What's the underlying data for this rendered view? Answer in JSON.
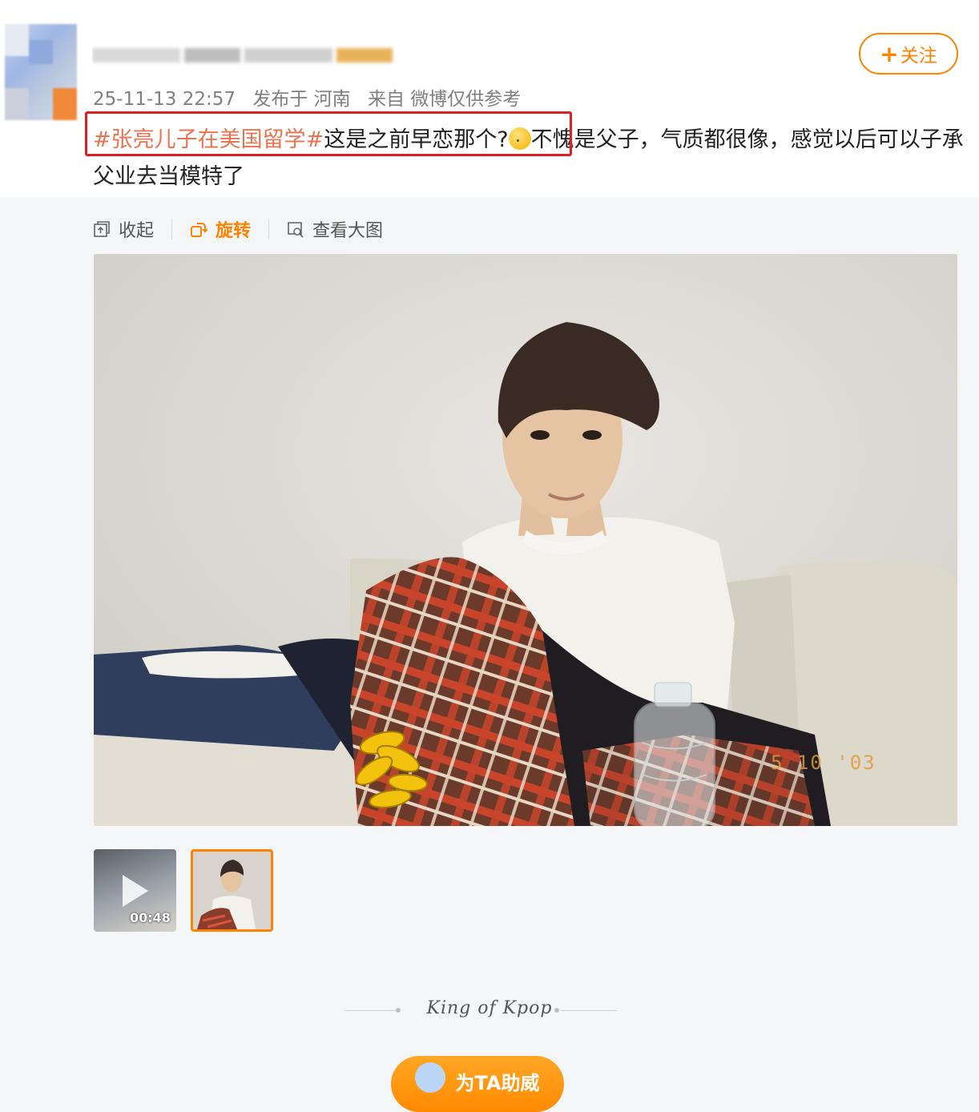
{
  "post": {
    "meta_time": "25-11-13 22:57",
    "meta_location": "发布于 河南",
    "meta_source": "来自 微博仅供参考",
    "follow_label": "关注",
    "follow_plus": "+",
    "hashtag": "#张亮儿子在美国留学#",
    "text_part1": "这是之前早恋那个?",
    "text_part2": "不愧是父子，气质都很像，感觉以后可以子承父业去当模特了",
    "emoji_name": "thinking-emoji-icon"
  },
  "toolbar": {
    "collapse_label": "收起",
    "rotate_label": "旋转",
    "view_large_label": "查看大图"
  },
  "photo": {
    "date_stamp": "5 10 '03"
  },
  "thumbnails": [
    {
      "type": "video",
      "duration": "00:48"
    },
    {
      "type": "image",
      "selected": true
    }
  ],
  "footer": {
    "signature": "King of Kpop",
    "boost_label": "为TA助威"
  },
  "colors": {
    "accent": "#ff8200",
    "hashtag": "#eb7350",
    "highlight_box": "#e02020"
  }
}
